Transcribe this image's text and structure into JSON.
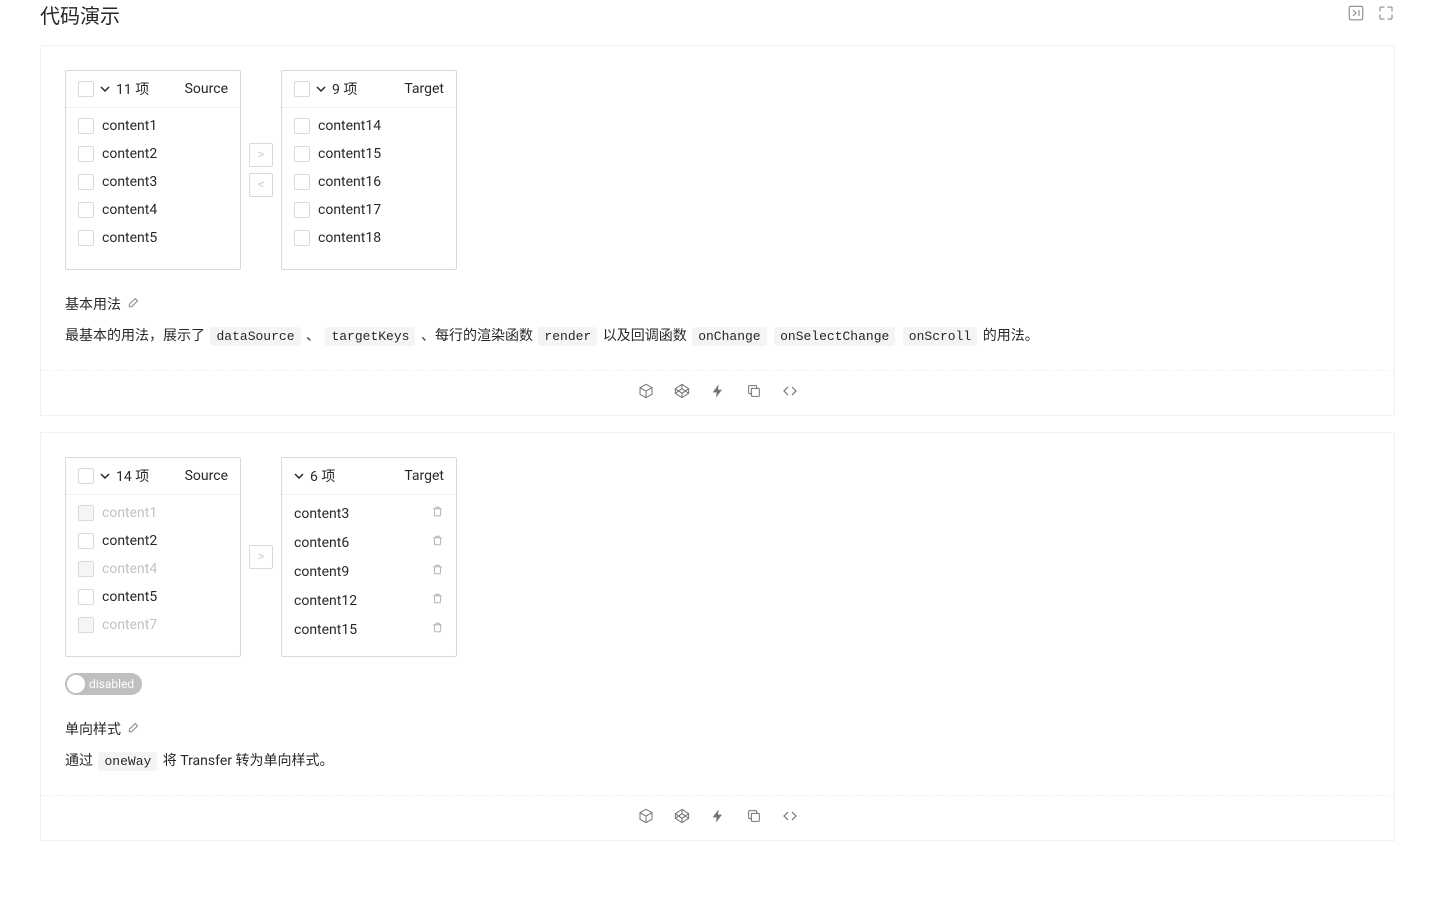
{
  "page_title": "代码演示",
  "demo1": {
    "source": {
      "count_label": "11 项",
      "title": "Source",
      "items": [
        "content1",
        "content2",
        "content3",
        "content4",
        "content5"
      ]
    },
    "target": {
      "count_label": "9 项",
      "title": "Target",
      "items": [
        "content14",
        "content15",
        "content16",
        "content17",
        "content18"
      ]
    },
    "title": "基本用法",
    "desc_pre": "最基本的用法，展示了 ",
    "code1": "dataSource",
    "sep1": " 、 ",
    "code2": "targetKeys",
    "sep2": " 、每行的渲染函数 ",
    "code3": "render",
    "sep3": " 以及回调函数 ",
    "code4": "onChange",
    "code5": "onSelectChange",
    "code6": "onScroll",
    "desc_post": " 的用法。"
  },
  "demo2": {
    "source": {
      "count_label": "14 项",
      "title": "Source",
      "items": [
        {
          "label": "content1",
          "disabled": true
        },
        {
          "label": "content2",
          "disabled": false
        },
        {
          "label": "content4",
          "disabled": true
        },
        {
          "label": "content5",
          "disabled": false
        },
        {
          "label": "content7",
          "disabled": true
        }
      ]
    },
    "target": {
      "count_label": "6 项",
      "title": "Target",
      "items": [
        "content3",
        "content6",
        "content9",
        "content12",
        "content15"
      ]
    },
    "switch_label": "disabled",
    "title": "单向样式",
    "desc_pre": "通过 ",
    "code1": "oneWay",
    "desc_post": " 将 Transfer 转为单向样式。"
  }
}
